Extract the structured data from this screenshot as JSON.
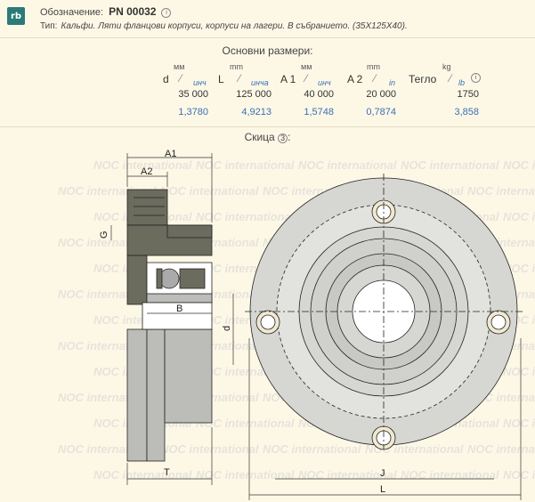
{
  "header": {
    "logo_text": "rb",
    "designation_label": "Обозначение:",
    "designation_value": "PN 00032",
    "info_icon": "ⓘ",
    "type_label": "Тип:",
    "type_value": "Кальфи. Ляти фланцови корпуси, корпуси на лагери. В събранието. (35X125X40)."
  },
  "dimensions": {
    "title": "Основни размери:",
    "columns": [
      {
        "symbol": "d",
        "unit_top": "мм",
        "unit_bot": "инч",
        "mm": "35 000",
        "inch": "1,3780"
      },
      {
        "symbol": "L",
        "unit_top": "mm",
        "unit_bot": "инча",
        "mm": "125 000",
        "inch": "4,9213"
      },
      {
        "symbol": "A 1",
        "unit_top": "мм",
        "unit_bot": "инч",
        "mm": "40 000",
        "inch": "1,5748"
      },
      {
        "symbol": "A 2",
        "unit_top": "mm",
        "unit_bot": "in",
        "mm": "20 000",
        "inch": "0,7874"
      },
      {
        "symbol": "Тегло",
        "unit_top": "kg",
        "unit_bot": "lb",
        "mm": "1750",
        "inch": "3,858"
      }
    ]
  },
  "sketch": {
    "title": "Скица",
    "watermark": "NOC international",
    "labels": {
      "A1": "A1",
      "A2": "A2",
      "G": "G",
      "B": "B",
      "d": "d",
      "T": "T",
      "J": "J",
      "L": "L"
    }
  },
  "colors": {
    "background": "#fdf8e6",
    "housing": "#6b6b5e",
    "link": "#3b6fb5"
  }
}
